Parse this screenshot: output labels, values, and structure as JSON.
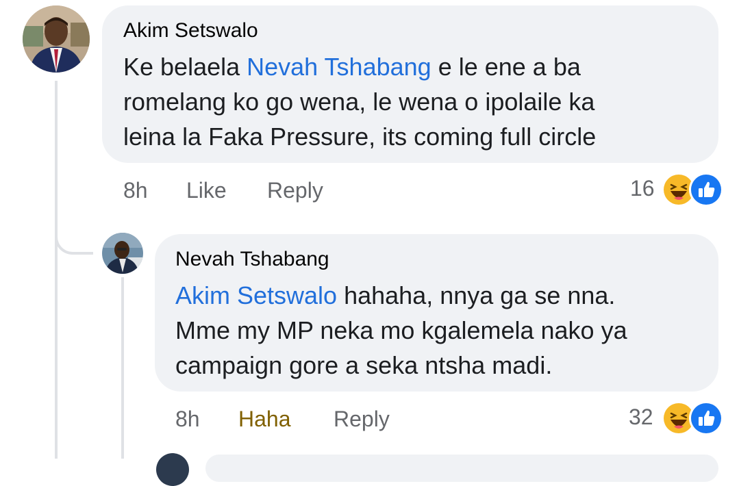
{
  "comments": [
    {
      "author": "Akim Setswalo",
      "mention": "Nevah Tshabang",
      "lines": [
        " e le ene a ba",
        "romelang ko go wena, le wena o ipolaile ka",
        "leina la Faka Pressure, its coming full circle"
      ],
      "line1_prefix": "Ke belaela ",
      "time": "8h",
      "like_label": "Like",
      "reply_label": "Reply",
      "reaction_count": "16",
      "reactions": [
        "haha-icon",
        "like-icon"
      ]
    },
    {
      "author": "Nevah Tshabang",
      "mention": "Akim Setswalo",
      "lines": [
        " hahaha, nnya ga se nna.",
        "Mme my MP neka mo kgalemela nako ya",
        "campaign gore a seka ntsha madi."
      ],
      "time": "8h",
      "like_label": "Haha",
      "reply_label": "Reply",
      "reaction_count": "32",
      "reactions": [
        "haha-icon",
        "like-icon"
      ]
    }
  ],
  "colors": {
    "mention": "#216fdb",
    "haha_active": "#806000",
    "bubble": "#f0f2f5",
    "like_blue": "#1877f2",
    "haha_yellow": "#f7b928"
  }
}
